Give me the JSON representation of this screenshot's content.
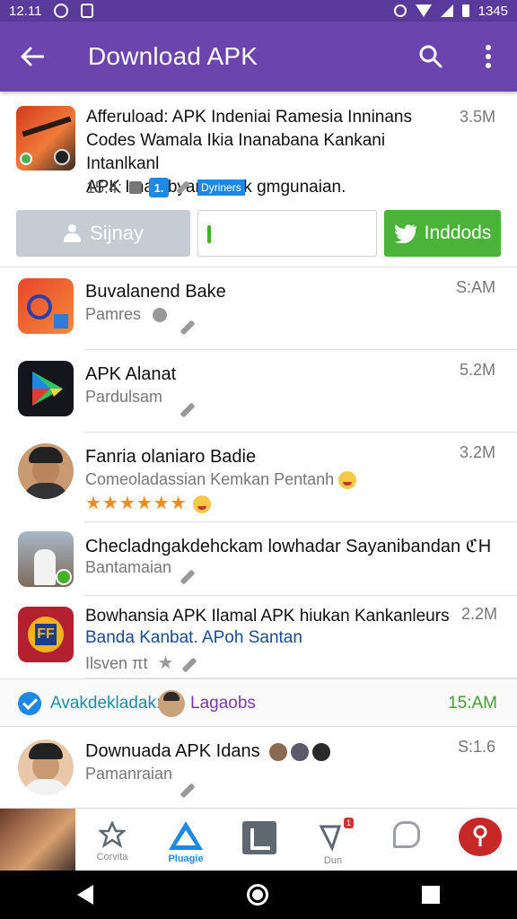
{
  "status_bar": {
    "time": "12.11",
    "right_text": "1345"
  },
  "app_bar": {
    "title": "Download APK"
  },
  "featured": {
    "line1": "Afferuload: APK Indeniai Ramesia Inninans",
    "line2": "Codes Wamala Ikia Inanabana Kankani Intanlkanl",
    "line3": "APK Iman byarllarra k gmgunaian.",
    "size": "3.5M",
    "meta_time": "15:4:",
    "meta_badge": "1.",
    "meta_tag": "Dyriners",
    "btn_left": "Sijnay",
    "btn_right": "Inddods"
  },
  "rows": [
    {
      "title": "Buvalanend Bake",
      "subtitle": "Pamres",
      "size": "S:AM"
    },
    {
      "title": "APK Alanat",
      "subtitle": "Pardulsam",
      "size": "5.2M"
    },
    {
      "title": "Fanria olaniaro Badie",
      "subtitle": "Comeoladassian Kemkan Pentanh",
      "size": "3.2M",
      "stars": "★★★★★★"
    },
    {
      "title": "Checladngakdehckam lowhadar Sayanibandan",
      "title_suffix": "ℭH",
      "subtitle": "Bantamaian",
      "size": ""
    },
    {
      "title": "Bowhansia APK Ilamal APK hiukan Kankanleurs",
      "size": "2.2M",
      "subtitle_link": "Banda Kanbat. APoh Santan",
      "subtitle": "Ilsven πt"
    }
  ],
  "section": {
    "label": "Avakdekladak:",
    "link": "Lagaobs",
    "time": "15:AM"
  },
  "last_row": {
    "title": "Downuada APK Idans",
    "subtitle": "Pamanraian",
    "size": "S:1.6"
  },
  "bottom_nav": {
    "items": [
      {
        "label": "Corvita"
      },
      {
        "label": "Pluagie"
      },
      {
        "label": ""
      },
      {
        "label": "Dun",
        "tag": "1"
      },
      {
        "label": ""
      },
      {
        "label": ""
      }
    ]
  },
  "colors": {
    "app_bar": "#6b45ad",
    "status_bar": "#5a3a9a",
    "green": "#4cb33a",
    "blue": "#1e88e5",
    "grey_button": "#c5ccd3"
  }
}
